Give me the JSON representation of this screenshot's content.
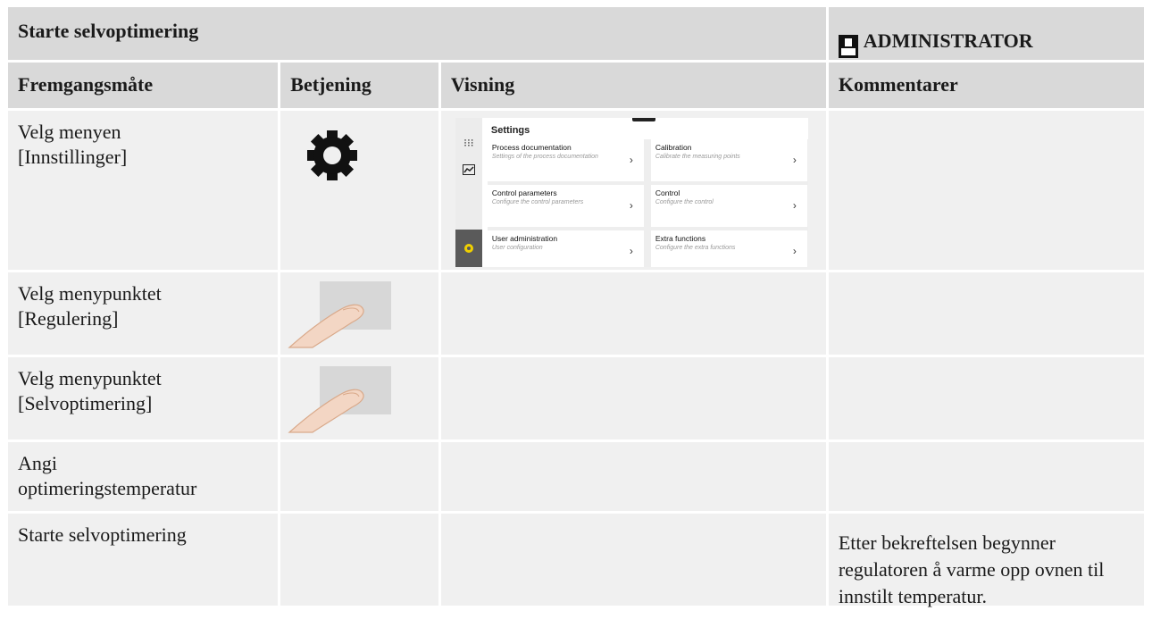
{
  "header": {
    "title": "Starte selvoptimering",
    "role": "ADMINISTRATOR"
  },
  "columns": [
    "Fremgangsmåte",
    "Betjening",
    "Visning",
    "Kommentarer"
  ],
  "rows": [
    {
      "step": "Velg menyen [Innstillinger]",
      "control": "gear-icon",
      "comment": ""
    },
    {
      "step": "Velg menypunktet [Regulering]",
      "control": "hand-tap-icon",
      "comment": ""
    },
    {
      "step": "Velg menypunktet [Selvoptimering]",
      "control": "hand-tap-icon",
      "comment": ""
    },
    {
      "step": "Angi optimeringstemperatur",
      "control": "",
      "comment": ""
    },
    {
      "step": "Starte selvoptimering",
      "control": "",
      "comment": "Etter bekreftelsen begynner regulatoren å varme opp ovnen til innstilt temperatur."
    }
  ],
  "screenshot": {
    "title": "Settings",
    "tiles": [
      {
        "name": "Process documentation",
        "desc": "Settings of the process documentation"
      },
      {
        "name": "Calibration",
        "desc": "Calibrate the measuring points"
      },
      {
        "name": "Control parameters",
        "desc": "Configure the control parameters"
      },
      {
        "name": "Control",
        "desc": "Configure the control"
      },
      {
        "name": "User administration",
        "desc": "User configuration"
      },
      {
        "name": "Extra functions",
        "desc": "Configure the extra functions"
      }
    ],
    "chevron": "›"
  },
  "colors": {
    "header_bg": "#d9d9d9",
    "cell_bg": "#f0f0f0",
    "active_icon": "#f0d000"
  }
}
